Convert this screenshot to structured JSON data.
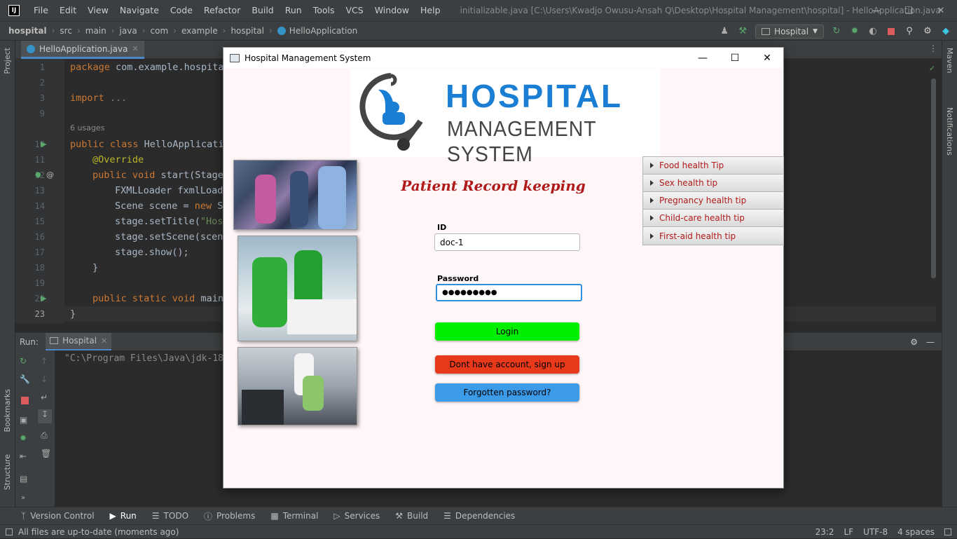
{
  "ide": {
    "menu": [
      "File",
      "Edit",
      "View",
      "Navigate",
      "Code",
      "Refactor",
      "Build",
      "Run",
      "Tools",
      "VCS",
      "Window",
      "Help"
    ],
    "window_title": "initializable.java [C:\\Users\\Kwadjo Owusu-Ansah Q\\Desktop\\Hospital Management\\hospital] - HelloApplication.java",
    "breadcrumbs": [
      "hospital",
      "src",
      "main",
      "java",
      "com",
      "example",
      "hospital",
      "HelloApplication"
    ],
    "run_config": "Hospital",
    "left_tools": [
      "Project",
      "Bookmarks",
      "Structure"
    ],
    "right_tools": [
      "Maven",
      "Notifications"
    ],
    "editor_tab": "HelloApplication.java",
    "usages": "6 usages",
    "line_numbers": [
      "1",
      "2",
      "3",
      "9",
      "10",
      "11",
      "12",
      "13",
      "14",
      "15",
      "16",
      "17",
      "18",
      "19",
      "20",
      "23"
    ],
    "run_label": "Run:",
    "run_tab": "Hospital",
    "console_text": "\"C:\\Program Files\\Java\\jdk-18",
    "bottom_tabs": [
      "Version Control",
      "Run",
      "TODO",
      "Problems",
      "Terminal",
      "Services",
      "Build",
      "Dependencies"
    ],
    "status_text": "All files are up-to-date (moments ago)",
    "status_right": [
      "23:2",
      "LF",
      "UTF-8",
      "4 spaces"
    ]
  },
  "code": {
    "l1_kw": "package",
    "l1_rest": " com.example.hospita",
    "l3_kw": "import",
    "l3_rest": " ...",
    "l10_kw": "public class",
    "l10_rest": " HelloApplicatio",
    "l11": "@Override",
    "l12_kw": "public void",
    "l12_rest": " start(Stage",
    "l13": "FXMLLoader fxmlLoade",
    "l14_a": "Scene scene = ",
    "l14_kw": "new",
    "l14_b": " Sc",
    "l15_a": "stage.setTitle(",
    "l15_st": "\"Hosp",
    "l16": "stage.setScene(scene",
    "l17": "stage.show();",
    "l18": "}",
    "l20_kw": "public static void",
    "l20_rest": " main",
    "l23": "}"
  },
  "app": {
    "title": "Hospital Management System",
    "logo_line1": "HOSPITAL",
    "logo_line2": "MANAGEMENT SYSTEM",
    "heading": "Patient Record keeping",
    "id_label": "ID",
    "id_value": "doc-1",
    "password_label": "Password",
    "password_value": "●●●●●●●●●",
    "login": "Login",
    "signup": "Dont have account, sign up",
    "forgot": "Forgotten password?",
    "tips": [
      "Food health Tip",
      "Sex health tip",
      "Pregnancy health tip",
      "Child-care health tip",
      "First-aid health tip"
    ],
    "colors": {
      "login": "#00ee00",
      "signup": "#e83a1b",
      "forgot": "#3c9be8",
      "heading": "#b01a1a",
      "logo_blue": "#1a7fd4",
      "logo_gray": "#444444"
    }
  }
}
